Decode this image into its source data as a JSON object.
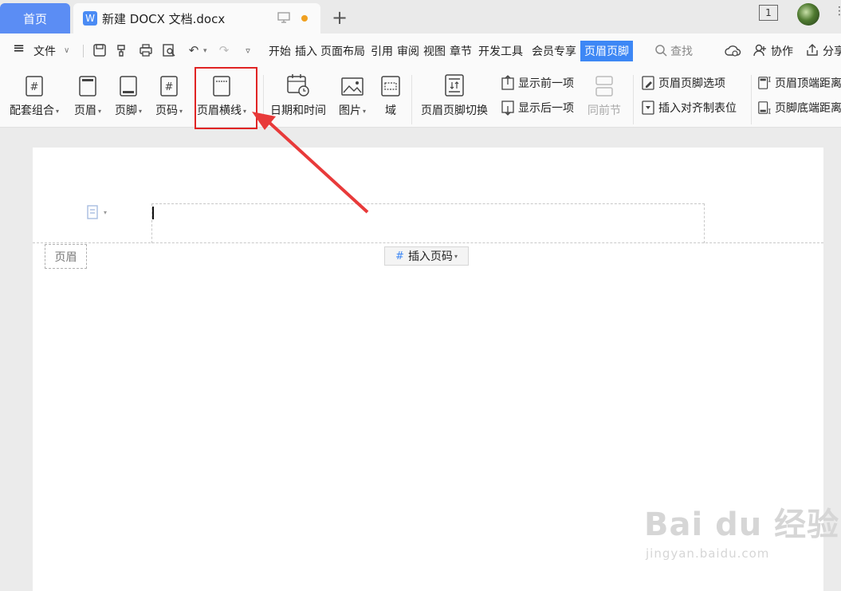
{
  "tabs": {
    "home": "首页",
    "doc_icon": "W",
    "doc_title": "新建 DOCX 文档.docx",
    "new_tab": "+",
    "window_count": "1"
  },
  "menu": {
    "hamburger": "≡",
    "file": "文件",
    "items": [
      "开始",
      "插入",
      "页面布局",
      "引用",
      "审阅",
      "视图",
      "章节",
      "开发工具",
      "会员专享",
      "页眉页脚"
    ],
    "search": "查找",
    "collab": "协作",
    "share": "分享"
  },
  "ribbon": {
    "set_combo": "配套组合",
    "header": "页眉",
    "footer": "页脚",
    "page_number": "页码",
    "header_line": "页眉横线",
    "datetime": "日期和时间",
    "picture": "图片",
    "field": "域",
    "switch": "页眉页脚切换",
    "show_prev": "显示前一项",
    "show_next": "显示后一项",
    "same_as_prev": "同前节",
    "hf_options": "页眉页脚选项",
    "insert_align_tab": "插入对齐制表位",
    "header_top_dist": "页眉顶端距离",
    "footer_bottom_dist": "页脚底端距离"
  },
  "page": {
    "header_label": "页眉",
    "insert_page_number": "插入页码"
  },
  "watermark": {
    "main": "Bai du 经验",
    "sub": "jingyan.baidu.com"
  },
  "colors": {
    "accent": "#3d87f5",
    "home_tab": "#5b8df4",
    "highlight": "#e02424",
    "modified_dot": "#f0a020"
  }
}
